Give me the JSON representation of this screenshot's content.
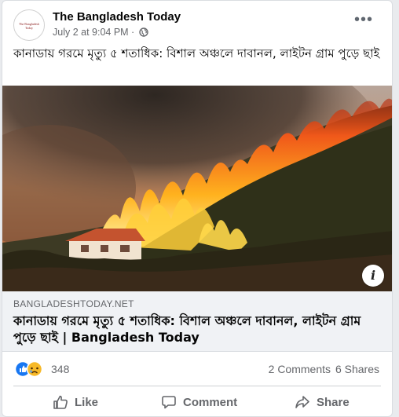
{
  "post": {
    "page_name": "The Bangladesh Today",
    "avatar_logo_text": "The Bangladesh Today",
    "timestamp": "July 2 at 9:04 PM",
    "separator": " · ",
    "privacy_icon": "globe-icon",
    "more_icon": "more-options-icon",
    "text": "কানাডায় গরমে মৃত্যু ৫ শতাধিক: বিশাল অঞ্চলে দাবানল, লাইটন গ্রাম পুড়ে ছাই"
  },
  "link_preview": {
    "domain": "BANGLADESHTODAY.NET",
    "title": "কানাডায় গরমে মৃত্যু ৫ শতাধিক: বিশাল অঞ্চলে দাবানল, লাইটন গ্রাম পুড়ে ছাই | Bangladesh Today",
    "info_icon": "info-icon",
    "info_label": "i"
  },
  "engagement": {
    "reaction_icons": [
      "like-reaction-icon",
      "sad-reaction-icon"
    ],
    "reaction_count": "348",
    "comments": "2 Comments",
    "shares": "6 Shares"
  },
  "actions": {
    "like": "Like",
    "comment": "Comment",
    "share": "Share"
  },
  "colors": {
    "like_blue": "#1877f2",
    "sad_yellow": "#f7b928",
    "text_secondary": "#65676b"
  }
}
